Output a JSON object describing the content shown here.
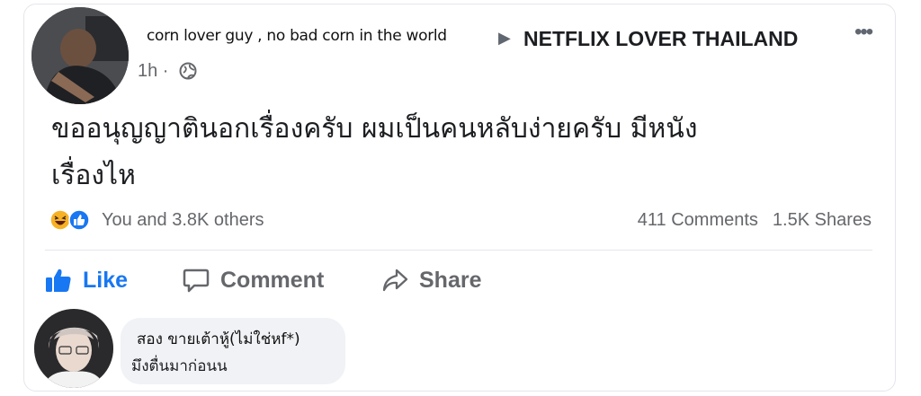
{
  "post": {
    "author": "corn lover guy , no bad corn in the world",
    "group": "NETFLIX LOVER THAILAND",
    "time": "1h ·",
    "text_line1": "ขออนุญญาตินอกเรื่องครับ ผมเป็นคนหลับง่ายครับ มีหนัง",
    "text_line2": "เรื่องไห",
    "reactions_icons": [
      "haha-icon",
      "like-icon"
    ],
    "reactors": "You and 3.8K others",
    "comments_count": "411 Comments",
    "shares_count": "1.5K Shares"
  },
  "actions": {
    "like": "Like",
    "comment": "Comment",
    "share": "Share"
  },
  "comment": {
    "name": "สอง ขายเต้าหู้(ไม่ใช่หf*)",
    "text": "มึงตื่นมาก่อนน"
  },
  "colors": {
    "accent": "#1877f2",
    "muted": "#65676b",
    "bubble": "#f0f2f5"
  }
}
